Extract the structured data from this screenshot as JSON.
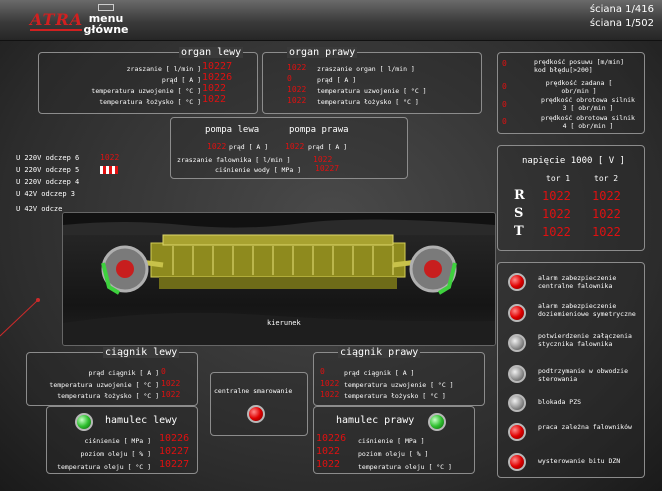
{
  "header": {
    "menu_line1": "menu",
    "menu_line2": "główne",
    "wall1": "ściana 1/416",
    "wall2": "ściana 1/502",
    "logo_text": "ATRA"
  },
  "organ_lewy": {
    "title": "organ lewy",
    "rows": [
      {
        "label": "zraszanie [ l/min ]",
        "value": "10227"
      },
      {
        "label": "prąd [ A ]",
        "value": "10226"
      },
      {
        "label": "temperatura uzwojenie [ °C ]",
        "value": "1022"
      },
      {
        "label": "temperatura łożysko [ °C ]",
        "value": "1022"
      }
    ]
  },
  "organ_prawy": {
    "title": "organ prawy",
    "rows": [
      {
        "label": "zraszanie organ [ l/min ]",
        "value": "1022"
      },
      {
        "label": "prąd [ A ]",
        "value": "0"
      },
      {
        "label": "temperatura uzwojenie [ °C ]",
        "value": "1022"
      },
      {
        "label": "temperatura łożysko [ °C ]",
        "value": "1022"
      }
    ]
  },
  "pompa": {
    "title_left": "pompa lewa",
    "title_right": "pompa prawa",
    "prad_label": "prąd [ A ]",
    "prad_left": "1022",
    "prad_right": "1022",
    "zraszanie_label": "zraszanie falownika [ l/min ]",
    "zraszanie_value": "1022",
    "cisnienie_label": "ciśnienie wody [ MPa ]",
    "cisnienie_value": "10227"
  },
  "speed": {
    "rows": [
      {
        "label": "prędkość posuwu [m/min]",
        "value": "0"
      },
      {
        "label": "kod błędu[>200]",
        "value": ""
      },
      {
        "label": "prędkość zadana [ obr/min ]",
        "value": "0"
      },
      {
        "label": "prędkość obrotowa silnik 3 [ obr/min ]",
        "value": "0"
      },
      {
        "label": "prędkość obrotowa silnik 4 [ obr/min ]",
        "value": "0"
      }
    ]
  },
  "odczepy": [
    {
      "label": "U 220V odczep 6",
      "value": "1022"
    },
    {
      "label": "U 220V odczep 5",
      "value": ""
    },
    {
      "label": "U 220V odczep 4",
      "value": ""
    },
    {
      "label": "U 42V odczep 3",
      "value": ""
    },
    {
      "label": "U 42V odcze",
      "value": ""
    }
  ],
  "napiecie": {
    "title": "napięcie 1000 [ V ]",
    "col1": "tor 1",
    "col2": "tor 2",
    "rows": [
      {
        "phase": "R",
        "v1": "1022",
        "v2": "1022"
      },
      {
        "phase": "S",
        "v1": "1022",
        "v2": "1022"
      },
      {
        "phase": "T",
        "v1": "1022",
        "v2": "1022"
      }
    ]
  },
  "machine": {
    "direction_label": "kierunek"
  },
  "alarms": [
    {
      "label": "alarm zabezpieczenie centralne falownika",
      "state": "red"
    },
    {
      "label": "alarm zabezpieczenie doziemieniowe symetryczne",
      "state": "red"
    },
    {
      "label": "potwierdzenie załączenia stycznika falownika",
      "state": "grey"
    },
    {
      "label": "podtrzymanie w obwodzie sterowania",
      "state": "grey"
    },
    {
      "label": "blokada PZS",
      "state": "grey"
    },
    {
      "label": "praca zależna falowników",
      "state": "red"
    },
    {
      "label": "wysterowanie bitu DZN",
      "state": "red"
    }
  ],
  "ciagnik_lewy": {
    "title": "ciągnik lewy",
    "rows": [
      {
        "label": "prąd ciągnik [ A ]",
        "value": "0"
      },
      {
        "label": "temperatura uzwojenie [ °C ]",
        "value": "1022"
      },
      {
        "label": "temperatura łożysko [ °C ]",
        "value": "1022"
      }
    ]
  },
  "ciagnik_prawy": {
    "title": "ciągnik prawy",
    "rows": [
      {
        "label": "prąd ciągnik [ A ]",
        "value": "0"
      },
      {
        "label": "temperatura uzwojenie [ °C ]",
        "value": "1022"
      },
      {
        "label": "temperatura łożysko [ °C ]",
        "value": "1022"
      }
    ]
  },
  "centralne": {
    "label": "centralne smarowanie",
    "state": "red"
  },
  "hamulec_lewy": {
    "title": "hamulec lewy",
    "state": "green",
    "rows": [
      {
        "label": "ciśnienie [ MPa ]",
        "value": "10226"
      },
      {
        "label": "poziom oleju [ % ]",
        "value": "10227"
      },
      {
        "label": "temperatura oleju [ °C ]",
        "value": "10227"
      }
    ]
  },
  "hamulec_prawy": {
    "title": "hamulec prawy",
    "state": "green",
    "rows": [
      {
        "label": "ciśnienie [ MPa ]",
        "value": "10226"
      },
      {
        "label": "poziom oleju [ % ]",
        "value": "1022"
      },
      {
        "label": "temperatura oleju [ °C ]",
        "value": "1022"
      }
    ]
  }
}
